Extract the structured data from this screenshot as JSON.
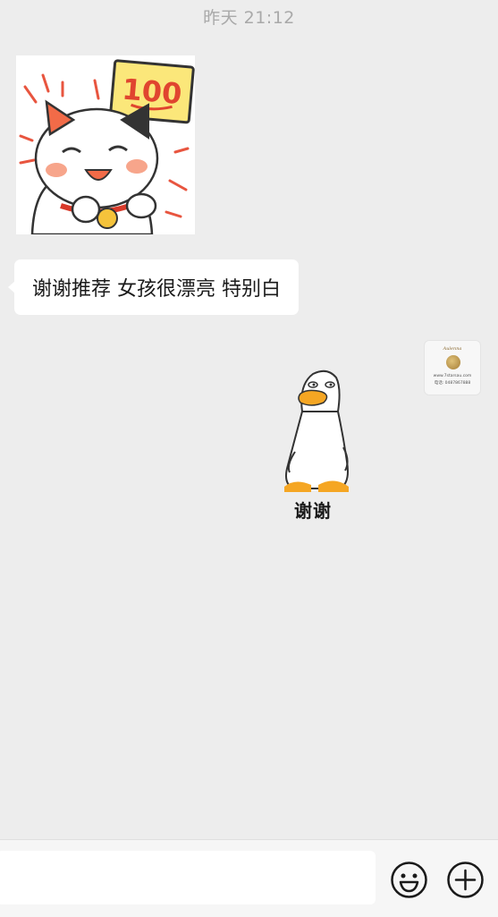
{
  "chat": {
    "timestamp": "昨天 21:12",
    "incoming_text": "谢谢推荐 女孩很漂亮 特别白",
    "sticker_cat": {
      "sign_text": "100"
    },
    "avatar": {
      "brand": "Aulenna",
      "website": "www.7starsau.com",
      "phone": "电话: 0487867888"
    },
    "sticker_duck": {
      "caption": "谢谢"
    }
  },
  "input_bar": {
    "value": "",
    "emoji_icon": "smiley-face-icon",
    "more_icon": "plus-circle-icon"
  }
}
